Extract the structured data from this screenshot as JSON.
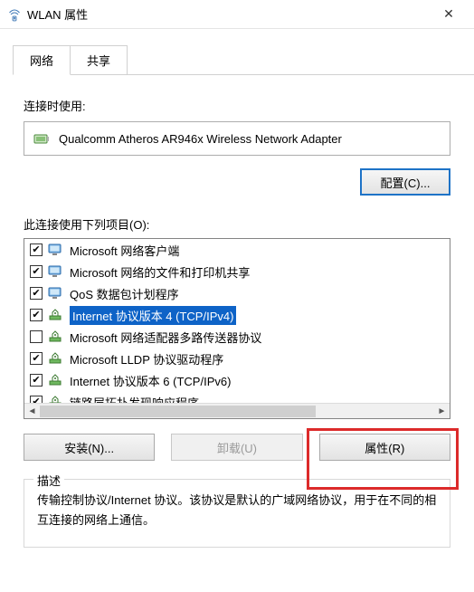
{
  "window": {
    "title": "WLAN 属性",
    "close_icon": "✕"
  },
  "tabs": [
    {
      "label": "网络",
      "active": true
    },
    {
      "label": "共享",
      "active": false
    }
  ],
  "connect_using_label": "连接时使用:",
  "adapter": {
    "name": "Qualcomm Atheros AR946x Wireless Network Adapter"
  },
  "configure_btn": "配置(C)...",
  "items_label": "此连接使用下列项目(O):",
  "items": [
    {
      "checked": true,
      "icon": "monitor",
      "label": "Microsoft 网络客户端",
      "selected": false
    },
    {
      "checked": true,
      "icon": "monitor",
      "label": "Microsoft 网络的文件和打印机共享",
      "selected": false
    },
    {
      "checked": true,
      "icon": "monitor-q",
      "label": "QoS 数据包计划程序",
      "selected": false
    },
    {
      "checked": true,
      "icon": "net",
      "label": "Internet 协议版本 4 (TCP/IPv4)",
      "selected": true
    },
    {
      "checked": false,
      "icon": "net",
      "label": "Microsoft 网络适配器多路传送器协议",
      "selected": false
    },
    {
      "checked": true,
      "icon": "net",
      "label": "Microsoft LLDP 协议驱动程序",
      "selected": false
    },
    {
      "checked": true,
      "icon": "net",
      "label": "Internet 协议版本 6 (TCP/IPv6)",
      "selected": false
    },
    {
      "checked": true,
      "icon": "net",
      "label": "链路层拓扑发现响应程序",
      "selected": false
    }
  ],
  "buttons": {
    "install": "安装(N)...",
    "uninstall": "卸载(U)",
    "properties": "属性(R)"
  },
  "description": {
    "legend": "描述",
    "text": "传输控制协议/Internet 协议。该协议是默认的广域网络协议，用于在不同的相互连接的网络上通信。"
  }
}
